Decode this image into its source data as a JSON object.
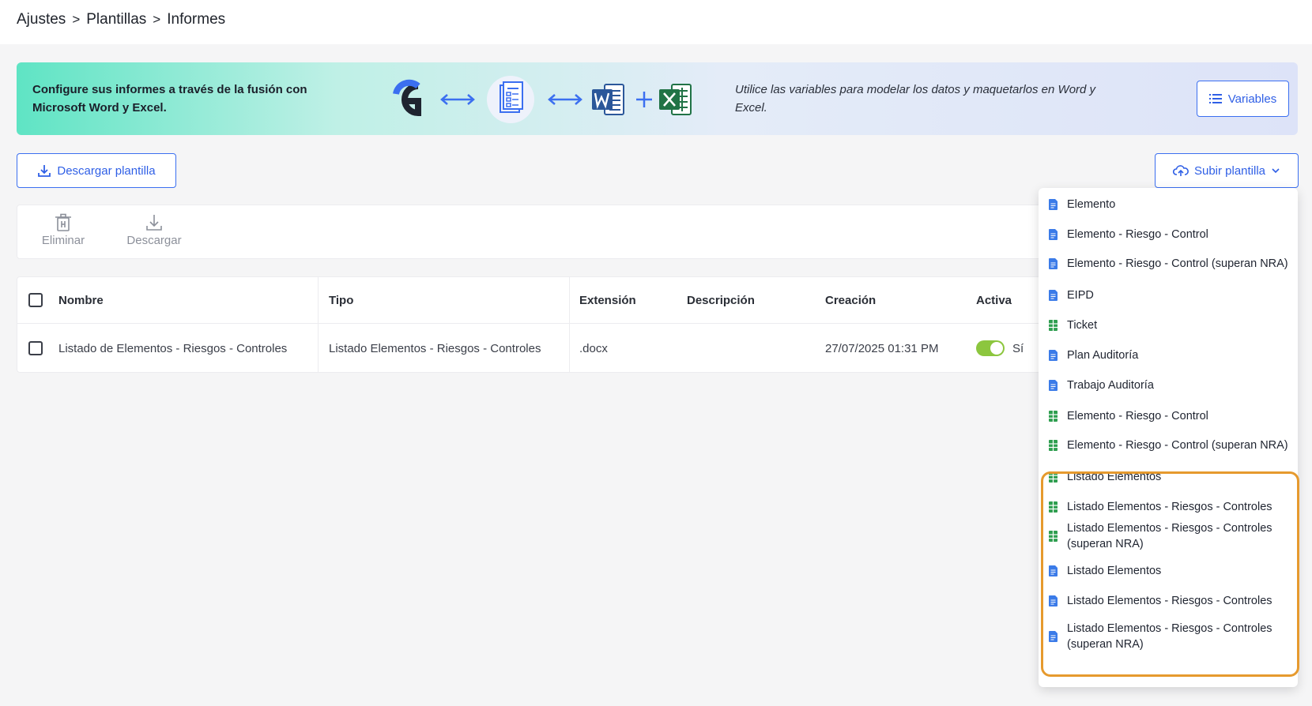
{
  "breadcrumb": {
    "items": [
      "Ajustes",
      "Plantillas",
      "Informes"
    ],
    "separator": ">"
  },
  "banner": {
    "left_text": "Configure sus informes a través de la fusión con Microsoft Word y Excel.",
    "right_text": "Utilice las variables para modelar los datos y maquetarlos en Word y Excel.",
    "variables_label": "Variables",
    "icons": [
      "g-logo-icon",
      "double-arrow-icon",
      "template-doc-icon",
      "double-arrow-icon",
      "word-icon",
      "plus-icon",
      "excel-icon"
    ]
  },
  "actions": {
    "download_template_label": "Descargar plantilla",
    "upload_template_label": "Subir plantilla"
  },
  "toolbar": {
    "delete_label": "Eliminar",
    "download_label": "Descargar"
  },
  "table": {
    "columns": [
      "Nombre",
      "Tipo",
      "Extensión",
      "Descripción",
      "Creación",
      "Activa"
    ],
    "rows": [
      {
        "name": "Listado de Elementos - Riesgos - Controles",
        "type": "Listado Elementos - Riesgos - Controles",
        "extension": ".docx",
        "description": "",
        "created": "27/07/2025 01:31 PM",
        "active": "Sí",
        "active_on": true
      }
    ]
  },
  "dropdown": {
    "items": [
      {
        "label": "Elemento",
        "kind": "word"
      },
      {
        "label": "Elemento - Riesgo - Control",
        "kind": "word"
      },
      {
        "label": "Elemento - Riesgo - Control (superan NRA)",
        "kind": "word"
      },
      {
        "label": "EIPD",
        "kind": "word"
      },
      {
        "label": "Ticket",
        "kind": "excel"
      },
      {
        "label": "Plan Auditoría",
        "kind": "word"
      },
      {
        "label": "Trabajo Auditoría",
        "kind": "word"
      },
      {
        "label": "Elemento - Riesgo - Control",
        "kind": "excel"
      },
      {
        "label": "Elemento - Riesgo - Control (superan NRA)",
        "kind": "excel"
      },
      {
        "label": "Listado Elementos",
        "kind": "excel"
      },
      {
        "label": "Listado Elementos - Riesgos - Controles",
        "kind": "excel"
      },
      {
        "label": "Listado Elementos - Riesgos - Controles (superan NRA)",
        "kind": "excel"
      },
      {
        "label": "Listado Elementos",
        "kind": "word"
      },
      {
        "label": "Listado Elementos - Riesgos - Controles",
        "kind": "word"
      },
      {
        "label": "Listado Elementos - Riesgos - Controles (superan NRA)",
        "kind": "word"
      }
    ]
  },
  "colors": {
    "accent": "#2f5fe6",
    "word_doc": "#3b7be8",
    "excel_doc": "#2e9e4f",
    "toggle_on": "#8cc63e",
    "highlight": "#e69a2e"
  }
}
